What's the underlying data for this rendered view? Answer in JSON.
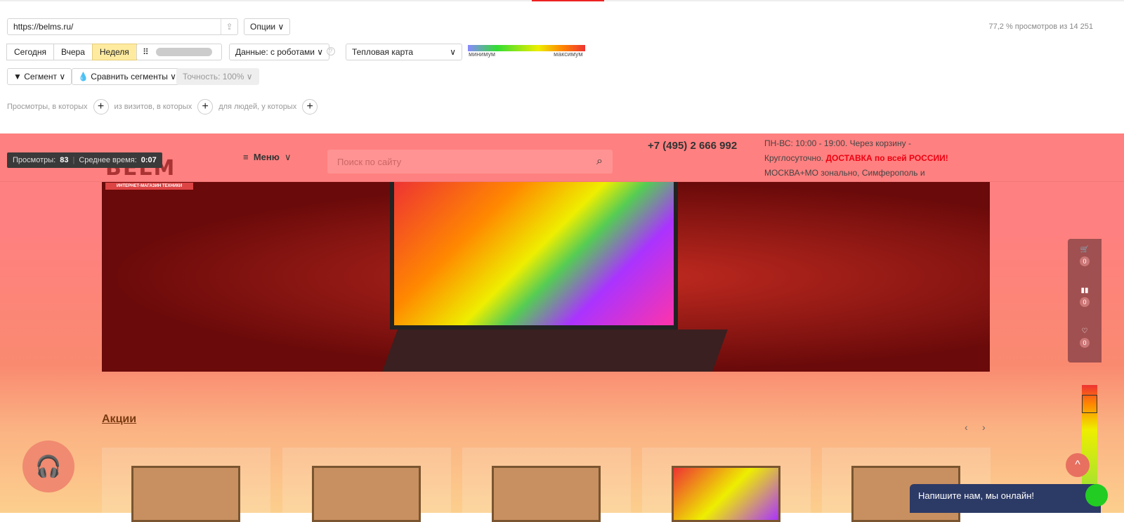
{
  "toolbar": {
    "url": "https://belms.ru/",
    "options": "Опции ∨",
    "stat": "77,2 % просмотров из 14 251",
    "periods": [
      "Сегодня",
      "Вчера",
      "Неделя"
    ],
    "data_mode": "Данные: с роботами ∨",
    "map_type": "Тепловая карта",
    "legend_min": "минимум",
    "legend_max": "максимум",
    "segment": "Сегмент ∨",
    "compare": "Сравнить сегменты ∨",
    "accuracy": "Точность: 100% ∨",
    "filter1": "Просмотры, в которых",
    "filter2": "из визитов, в которых",
    "filter3": "для людей, у которых"
  },
  "tooltip": {
    "views_label": "Просмотры:",
    "views": "83",
    "time_label": "Среднее время:",
    "time": "0:07"
  },
  "site": {
    "logo": "BELM",
    "logo_sub": "ИНТЕРНЕТ-МАГАЗИН ТЕХНИКИ",
    "menu": "Меню",
    "search_placeholder": "Поиск по сайту",
    "phone": "+7 (495) 2 666 992",
    "info1": "ПН-ВС: 10:00 - 19:00. Через корзину - Круглосуточно.",
    "info_bold": "ДОСТАВКА по всей РОССИИ!",
    "info2": "МОСКВА+МО зонально, Симферополь и САНКТ-ПЕТЕРБУРГ - БЕСПЛАТНАЯ ДОСТАВКА!",
    "cart_count": "0",
    "compare_count": "0",
    "fav_count": "0",
    "section": "Акции",
    "chat": "Напишите нам, мы онлайн!"
  }
}
